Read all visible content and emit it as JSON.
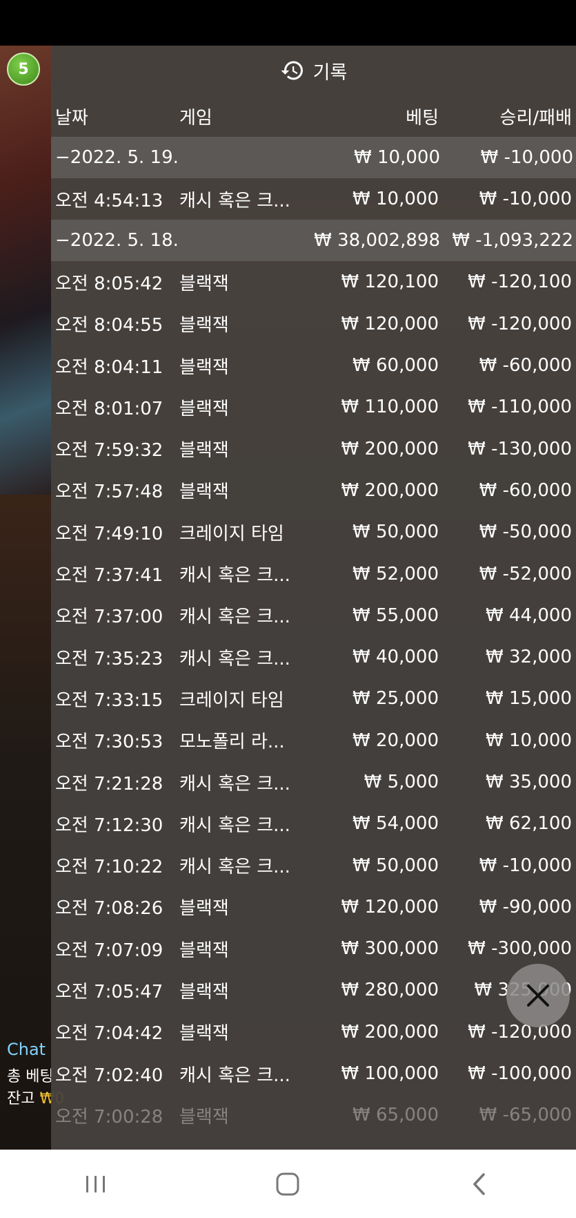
{
  "badge": "5",
  "overlay": {
    "chat": "Chat",
    "total_bet": "총 베팅",
    "balance": "잔고",
    "balance_value": "₩0"
  },
  "panel": {
    "title": "기록",
    "columns": {
      "date": "날짜",
      "game": "게임",
      "bet": "베팅",
      "result": "승리/패배"
    },
    "rows": [
      {
        "type": "group",
        "date": "−2022. 5. 19.",
        "game": "",
        "bet": "₩ 10,000",
        "result": "₩ -10,000"
      },
      {
        "type": "row",
        "date": "오전 4:54:13",
        "game": "캐시 혹은 크...",
        "bet": "₩ 10,000",
        "result": "₩ -10,000"
      },
      {
        "type": "group",
        "date": "−2022. 5. 18.",
        "game": "",
        "bet": "₩ 38,002,898",
        "result": "₩ -1,093,222"
      },
      {
        "type": "row",
        "date": "오전 8:05:42",
        "game": "블랙잭",
        "bet": "₩ 120,100",
        "result": "₩ -120,100"
      },
      {
        "type": "row",
        "date": "오전 8:04:55",
        "game": "블랙잭",
        "bet": "₩ 120,000",
        "result": "₩ -120,000"
      },
      {
        "type": "row",
        "date": "오전 8:04:11",
        "game": "블랙잭",
        "bet": "₩ 60,000",
        "result": "₩ -60,000"
      },
      {
        "type": "row",
        "date": "오전 8:01:07",
        "game": "블랙잭",
        "bet": "₩ 110,000",
        "result": "₩ -110,000"
      },
      {
        "type": "row",
        "date": "오전 7:59:32",
        "game": "블랙잭",
        "bet": "₩ 200,000",
        "result": "₩ -130,000"
      },
      {
        "type": "row",
        "date": "오전 7:57:48",
        "game": "블랙잭",
        "bet": "₩ 200,000",
        "result": "₩ -60,000"
      },
      {
        "type": "row",
        "date": "오전 7:49:10",
        "game": "크레이지 타임",
        "bet": "₩ 50,000",
        "result": "₩ -50,000"
      },
      {
        "type": "row",
        "date": "오전 7:37:41",
        "game": "캐시 혹은 크...",
        "bet": "₩ 52,000",
        "result": "₩ -52,000"
      },
      {
        "type": "row",
        "date": "오전 7:37:00",
        "game": "캐시 혹은 크...",
        "bet": "₩ 55,000",
        "result": "₩ 44,000"
      },
      {
        "type": "row",
        "date": "오전 7:35:23",
        "game": "캐시 혹은 크...",
        "bet": "₩ 40,000",
        "result": "₩ 32,000"
      },
      {
        "type": "row",
        "date": "오전 7:33:15",
        "game": "크레이지 타임",
        "bet": "₩ 25,000",
        "result": "₩ 15,000"
      },
      {
        "type": "row",
        "date": "오전 7:30:53",
        "game": "모노폴리 라...",
        "bet": "₩ 20,000",
        "result": "₩ 10,000"
      },
      {
        "type": "row",
        "date": "오전 7:21:28",
        "game": "캐시 혹은 크...",
        "bet": "₩ 5,000",
        "result": "₩ 35,000"
      },
      {
        "type": "row",
        "date": "오전 7:12:30",
        "game": "캐시 혹은 크...",
        "bet": "₩ 54,000",
        "result": "₩ 62,100"
      },
      {
        "type": "row",
        "date": "오전 7:10:22",
        "game": "캐시 혹은 크...",
        "bet": "₩ 50,000",
        "result": "₩ -10,000"
      },
      {
        "type": "row",
        "date": "오전 7:08:26",
        "game": "블랙잭",
        "bet": "₩ 120,000",
        "result": "₩ -90,000"
      },
      {
        "type": "row",
        "date": "오전 7:07:09",
        "game": "블랙잭",
        "bet": "₩ 300,000",
        "result": "₩ -300,000"
      },
      {
        "type": "row",
        "date": "오전 7:05:47",
        "game": "블랙잭",
        "bet": "₩ 280,000",
        "result": "₩ 325,000"
      },
      {
        "type": "row",
        "date": "오전 7:04:42",
        "game": "블랙잭",
        "bet": "₩ 200,000",
        "result": "₩ -120,000"
      },
      {
        "type": "row",
        "date": "오전 7:02:40",
        "game": "캐시 혹은 크...",
        "bet": "₩ 100,000",
        "result": "₩ -100,000"
      },
      {
        "type": "row",
        "date": "오전 7:00:28",
        "game": "블랙잭",
        "bet": "₩ 65,000",
        "result": "₩ -65,000"
      }
    ]
  },
  "close_icon": "close-icon",
  "navbar": {
    "recent_icon": "recent-apps-icon",
    "home_icon": "home-icon",
    "back_icon": "back-icon"
  }
}
